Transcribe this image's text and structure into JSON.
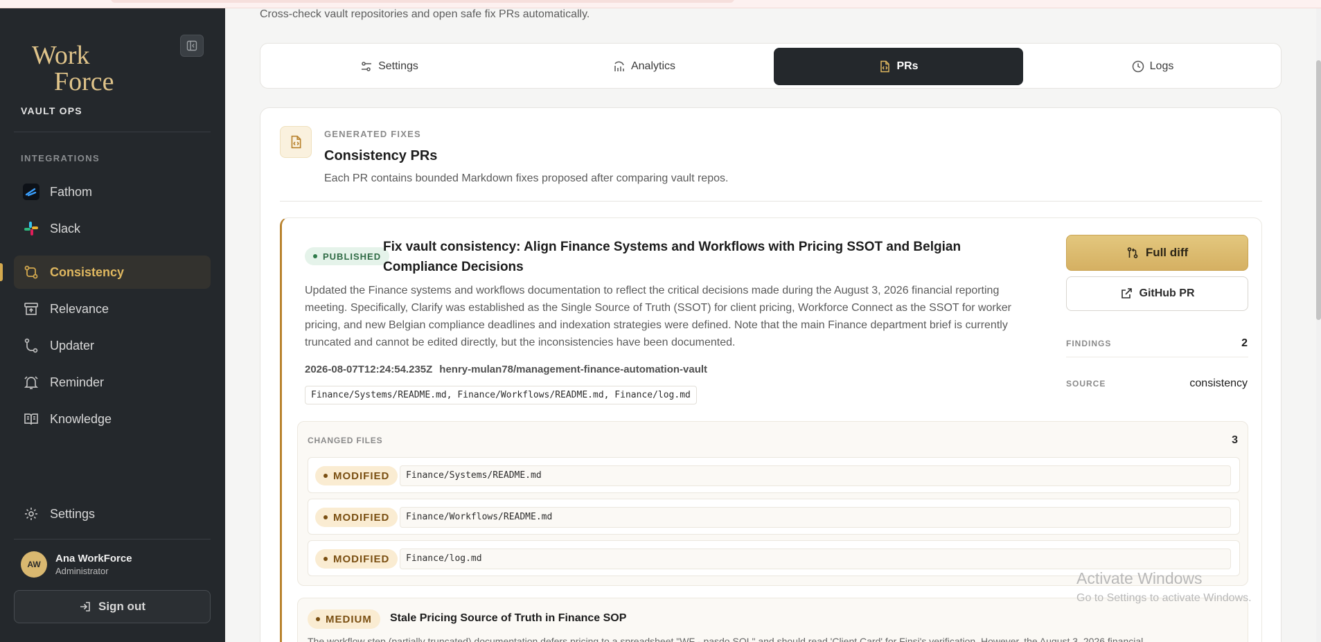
{
  "app": {
    "logo_text": "WorkForce",
    "org_name": "VAULT OPS"
  },
  "header": {
    "subtitle": "Cross-check vault repositories and open safe fix PRs automatically."
  },
  "sidebar": {
    "section_label": "INTEGRATIONS",
    "items": [
      {
        "label": "Fathom",
        "icon": "fathom-icon"
      },
      {
        "label": "Slack",
        "icon": "slack-icon"
      },
      {
        "label": "Consistency",
        "icon": "consistency-icon",
        "active": true
      },
      {
        "label": "Relevance",
        "icon": "relevance-icon"
      },
      {
        "label": "Updater",
        "icon": "updater-icon"
      },
      {
        "label": "Reminder",
        "icon": "bell-icon"
      },
      {
        "label": "Knowledge",
        "icon": "book-icon"
      }
    ],
    "settings_label": "Settings",
    "user": {
      "initials": "AW",
      "name": "Ana WorkForce",
      "role": "Administrator"
    },
    "signout_label": "Sign out"
  },
  "tabs": [
    {
      "label": "Settings",
      "icon": "sliders-icon"
    },
    {
      "label": "Analytics",
      "icon": "analytics-icon"
    },
    {
      "label": "PRs",
      "icon": "file-code-icon",
      "active": true
    },
    {
      "label": "Logs",
      "icon": "clock-icon"
    }
  ],
  "card": {
    "eyebrow": "GENERATED FIXES",
    "title": "Consistency PRs",
    "description": "Each PR contains bounded Markdown fixes proposed after comparing vault repos."
  },
  "pr": {
    "status": "PUBLISHED",
    "title": "Fix vault consistency: Align Finance Systems and Workflows with Pricing SSOT and Belgian Compliance Decisions",
    "body": "Updated the Finance systems and workflows documentation to reflect the critical decisions made during the August 3, 2026 financial reporting meeting. Specifically, Clarify was established as the Single Source of Truth (SSOT) for client pricing, Workforce Connect as the SSOT for worker pricing, and new Belgian compliance deadlines and indexation strategies were defined. Note that the main Finance department brief is currently truncated and cannot be edited directly, but the inconsistencies have been documented.",
    "timestamp": "2026-08-07T12:24:54.235Z",
    "repo": "henry-mulan78/management-finance-automation-vault",
    "files_summary": "Finance/Systems/README.md, Finance/Workflows/README.md, Finance/log.md",
    "full_diff_label": "Full diff",
    "github_label": "GitHub PR",
    "findings_label": "FINDINGS",
    "findings_value": "2",
    "source_label": "SOURCE",
    "source_value": "consistency",
    "changed_files_label": "CHANGED FILES",
    "changed_files_count": "3",
    "changed_files": [
      {
        "status": "MODIFIED",
        "path": "Finance/Systems/README.md"
      },
      {
        "status": "MODIFIED",
        "path": "Finance/Workflows/README.md"
      },
      {
        "status": "MODIFIED",
        "path": "Finance/log.md"
      }
    ],
    "finding": {
      "severity": "MEDIUM",
      "title": "Stale Pricing Source of Truth in Finance SOP",
      "body": "The workflow step (partially truncated) documentation defers pricing to a spreadsheet \"WF - pasdo SOL\" and should read 'Client Card' for Finsi's verification. However, the August 3, 2026 financial"
    }
  },
  "watermark": {
    "line1": "Activate Windows",
    "line2": "Go to Settings to activate Windows."
  },
  "colors": {
    "sidebar_bg": "#24282c",
    "accent_gold": "#d5b062",
    "active_tab_bg": "#24282c",
    "published_green": "#2f6b45",
    "modified_brown": "#7a4f12"
  }
}
